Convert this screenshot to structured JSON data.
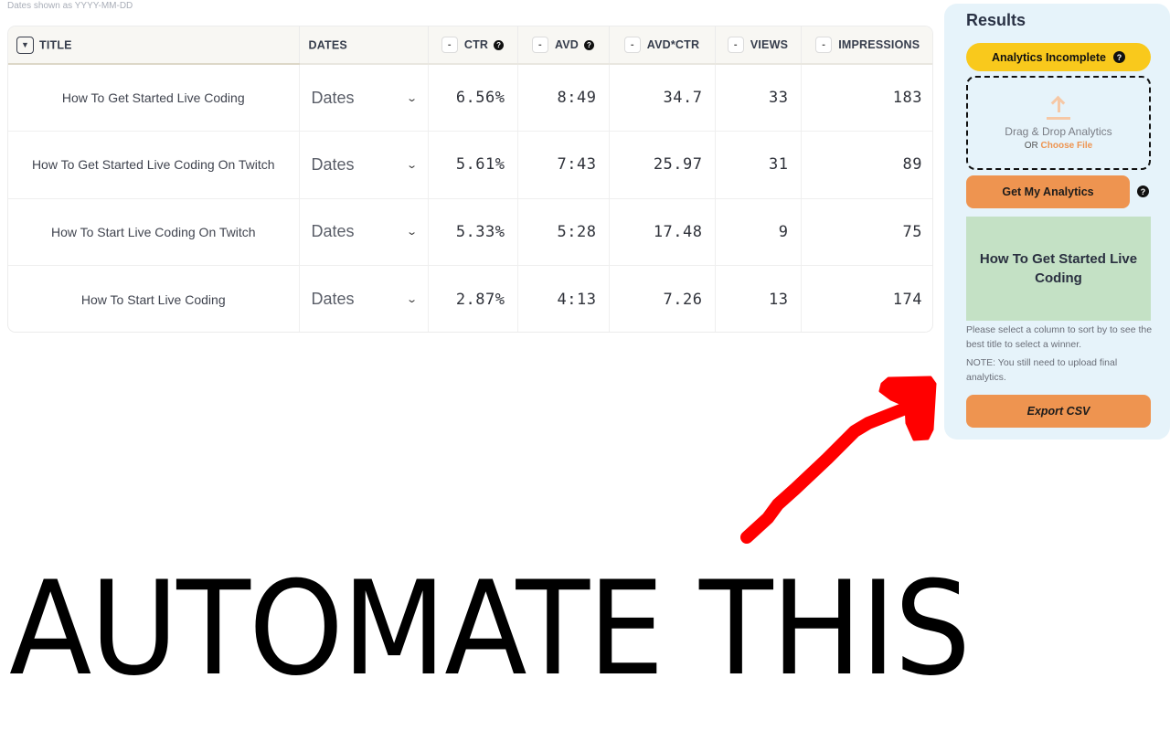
{
  "dates_hint": "Dates shown as YYYY-MM-DD",
  "table": {
    "sort_toggle_icon": "▼",
    "columns": [
      {
        "key": "title",
        "label": "TITLE",
        "has_sort_toggle": true
      },
      {
        "key": "dates",
        "label": "DATES"
      },
      {
        "key": "ctr",
        "label": "CTR",
        "has_minus": true,
        "has_help": true
      },
      {
        "key": "avd",
        "label": "AVD",
        "has_minus": true,
        "has_help": true
      },
      {
        "key": "avd_ctr",
        "label": "AVD*CTR",
        "has_minus": true
      },
      {
        "key": "views",
        "label": "VIEWS",
        "has_minus": true
      },
      {
        "key": "impressions",
        "label": "IMPRESSIONS",
        "has_minus": true
      }
    ],
    "minus_label": "-",
    "help_glyph": "?",
    "dates_select_label": "Dates",
    "dates_chevron": "⌄",
    "rows": [
      {
        "title": "How To Get Started Live Coding",
        "ctr": "6.56%",
        "avd": "8:49",
        "avd_ctr": "34.7",
        "views": "33",
        "impressions": "183"
      },
      {
        "title": "How To Get Started Live Coding On Twitch",
        "ctr": "5.61%",
        "avd": "7:43",
        "avd_ctr": "25.97",
        "views": "31",
        "impressions": "89"
      },
      {
        "title": "How To Start Live Coding On Twitch",
        "ctr": "5.33%",
        "avd": "5:28",
        "avd_ctr": "17.48",
        "views": "9",
        "impressions": "75"
      },
      {
        "title": "How To Start Live Coding",
        "ctr": "2.87%",
        "avd": "4:13",
        "avd_ctr": "7.26",
        "views": "13",
        "impressions": "174"
      }
    ]
  },
  "results": {
    "heading": "Results",
    "status": "Analytics Incomplete",
    "status_color": "#f9c91c",
    "dropzone": {
      "text": "Drag & Drop Analytics",
      "or_label": "OR",
      "choose_file": "Choose File",
      "icon": "upload-icon"
    },
    "get_analytics_button": "Get My Analytics",
    "winner_title": "How To Get Started Live Coding",
    "winner_bg": "#c4e1c5",
    "help_text": "Please select a column to sort by to see the best title to select a winner.",
    "note_text": "NOTE: You still need to upload final analytics.",
    "export_button": "Export CSV",
    "accent_color": "#ee9450"
  },
  "annotation": {
    "caption": "AUTOMATE THIS",
    "arrow_color": "#ff0000"
  }
}
